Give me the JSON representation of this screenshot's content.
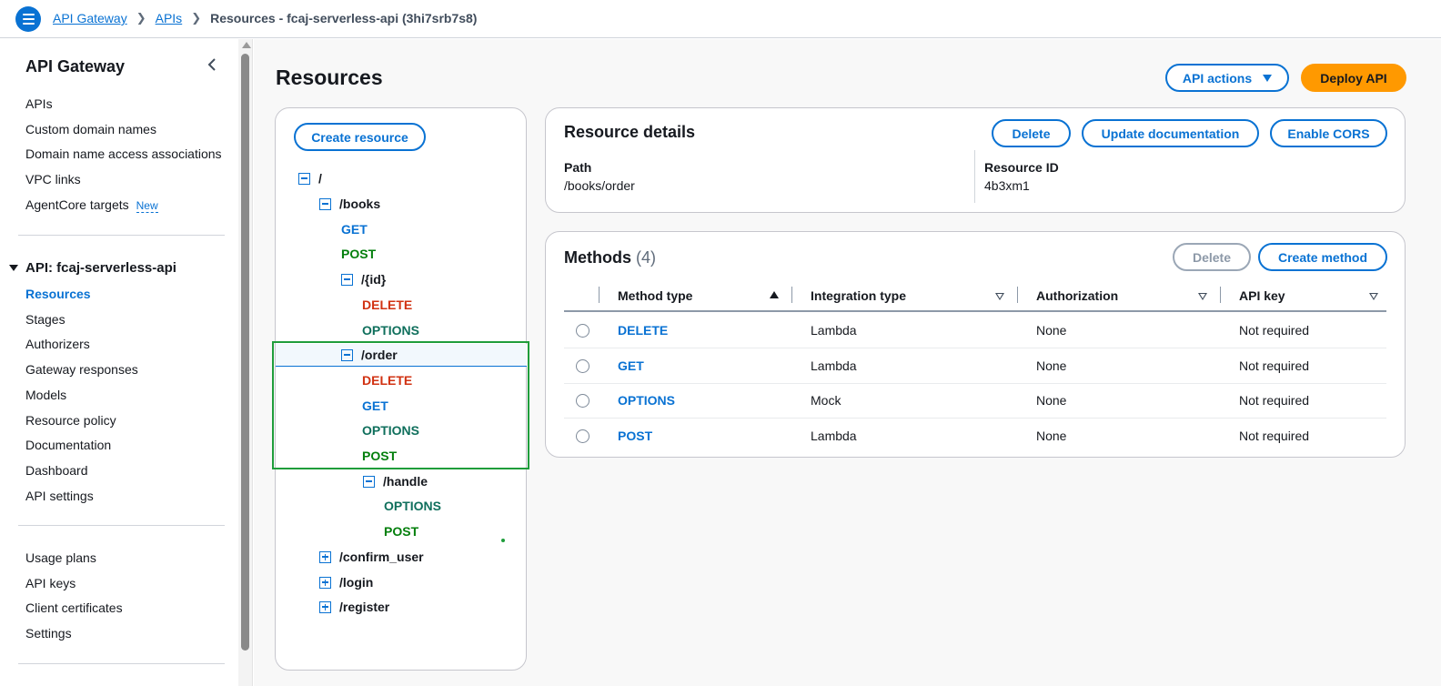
{
  "breadcrumb": {
    "items": [
      "API Gateway",
      "APIs"
    ],
    "current": "Resources - fcaj-serverless-api (3hi7srb7s8)"
  },
  "sidebar": {
    "title": "API Gateway",
    "top_items": [
      "APIs",
      "Custom domain names",
      "Domain name access associations",
      "VPC links",
      "AgentCore targets"
    ],
    "new_badge": "New",
    "section_title": "API: fcaj-serverless-api",
    "api_items": [
      "Resources",
      "Stages",
      "Authorizers",
      "Gateway responses",
      "Models",
      "Resource policy",
      "Documentation",
      "Dashboard",
      "API settings"
    ],
    "bottom_items": [
      "Usage plans",
      "API keys",
      "Client certificates",
      "Settings"
    ],
    "active_item": "Resources"
  },
  "main": {
    "title": "Resources",
    "api_actions_label": "API actions",
    "deploy_label": "Deploy API"
  },
  "tree": {
    "create_resource_label": "Create resource",
    "nodes": [
      {
        "label": "/",
        "kind": "resource",
        "expanded": true
      },
      {
        "label": "/books",
        "kind": "resource",
        "expanded": true
      },
      {
        "label": "GET",
        "kind": "get"
      },
      {
        "label": "POST",
        "kind": "post"
      },
      {
        "label": "/{id}",
        "kind": "resource",
        "expanded": true
      },
      {
        "label": "DELETE",
        "kind": "delete"
      },
      {
        "label": "OPTIONS",
        "kind": "options"
      },
      {
        "label": "/order",
        "kind": "resource",
        "expanded": true,
        "selected": true
      },
      {
        "label": "DELETE",
        "kind": "delete"
      },
      {
        "label": "GET",
        "kind": "get"
      },
      {
        "label": "OPTIONS",
        "kind": "options"
      },
      {
        "label": "POST",
        "kind": "post"
      },
      {
        "label": "/handle",
        "kind": "resource",
        "expanded": true
      },
      {
        "label": "OPTIONS",
        "kind": "options"
      },
      {
        "label": "POST",
        "kind": "post"
      },
      {
        "label": "/confirm_user",
        "kind": "resource",
        "expanded": false
      },
      {
        "label": "/login",
        "kind": "resource",
        "expanded": false
      },
      {
        "label": "/register",
        "kind": "resource",
        "expanded": false
      }
    ]
  },
  "details": {
    "title": "Resource details",
    "delete_label": "Delete",
    "update_doc_label": "Update documentation",
    "enable_cors_label": "Enable CORS",
    "path_label": "Path",
    "path_value": "/books/order",
    "resource_id_label": "Resource ID",
    "resource_id_value": "4b3xm1"
  },
  "methods": {
    "title": "Methods",
    "count": "(4)",
    "delete_label": "Delete",
    "create_label": "Create method",
    "columns": [
      "Method type",
      "Integration type",
      "Authorization",
      "API key"
    ],
    "rows": [
      {
        "method": "DELETE",
        "integration": "Lambda",
        "authorization": "None",
        "api_key": "Not required"
      },
      {
        "method": "GET",
        "integration": "Lambda",
        "authorization": "None",
        "api_key": "Not required"
      },
      {
        "method": "OPTIONS",
        "integration": "Mock",
        "authorization": "None",
        "api_key": "Not required"
      },
      {
        "method": "POST",
        "integration": "Lambda",
        "authorization": "None",
        "api_key": "Not required"
      }
    ]
  },
  "colors": {
    "link": "#0972d3",
    "deploy": "#ff9900",
    "highlight": "#1f9d3b"
  }
}
